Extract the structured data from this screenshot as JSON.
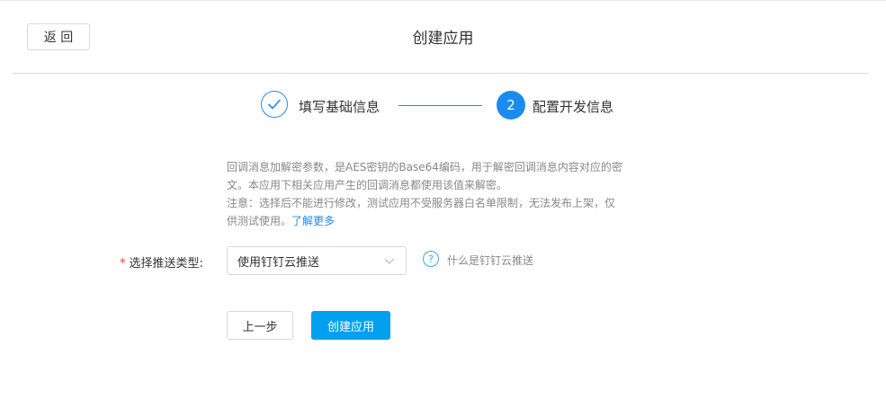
{
  "header": {
    "back_label": "返 回",
    "title": "创建应用"
  },
  "steps": {
    "step1_label": "填写基础信息",
    "step2_number": "2",
    "step2_label": "配置开发信息",
    "step1_icon": "check-icon",
    "accent_color": "#1a8cf0"
  },
  "description": {
    "line1": "回调消息加解密参数，是AES密钥的Base64编码，用于解密回调消息内容对应的密文。本应用下相关应用产生的回调消息都使用该值来解密。",
    "line2_prefix": "注意：选择后不能进行修改，测试应用不受服务器白名单限制，无法发布上架，仅供测试使用。",
    "learn_more": "了解更多"
  },
  "form": {
    "required_mark": "*",
    "push_type_label": "选择推送类型:",
    "push_type_value": "使用钉钉云推送",
    "help_icon": "question-circle-icon",
    "help_symbol": "?",
    "help_text": "什么是钉钉云推送"
  },
  "actions": {
    "prev_label": "上一步",
    "create_label": "创建应用",
    "primary_color": "#00a0f0"
  }
}
